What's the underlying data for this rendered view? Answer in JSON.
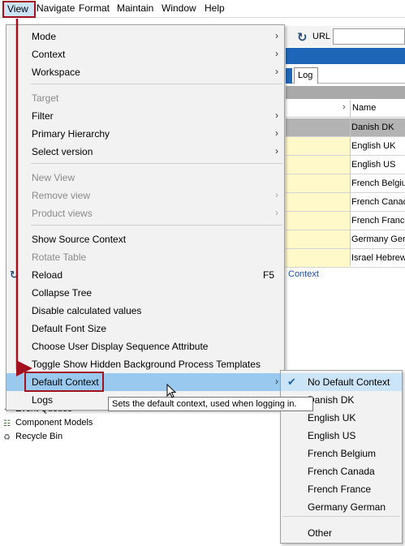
{
  "menubar": {
    "items": [
      "View",
      "Navigate",
      "Format",
      "Maintain",
      "Window",
      "Help"
    ]
  },
  "background": {
    "url_label": "URL",
    "log_tab": "Log",
    "column_name": "Name",
    "rows": [
      "Danish DK",
      "English UK",
      "English US",
      "French Belgium",
      "French Canada",
      "French France",
      "Germany German",
      "Israel Hebrew"
    ],
    "context_link": "Context",
    "tree": [
      "Event Queues",
      "Component Models",
      "Recycle Bin"
    ]
  },
  "view_menu": {
    "items": [
      {
        "label": "Mode",
        "submenu": true
      },
      {
        "label": "Context",
        "submenu": true
      },
      {
        "label": "Workspace",
        "submenu": true
      },
      {
        "label": "Target",
        "disabled": true
      },
      {
        "label": "Filter",
        "submenu": true
      },
      {
        "label": "Primary Hierarchy",
        "submenu": true
      },
      {
        "label": "Select version",
        "submenu": true
      },
      {
        "label": "New View",
        "disabled": true
      },
      {
        "label": "Remove view",
        "disabled": true,
        "submenu": true
      },
      {
        "label": "Product views",
        "disabled": true,
        "submenu": true
      },
      {
        "label": "Show Source Context"
      },
      {
        "label": "Rotate Table",
        "disabled": true
      },
      {
        "label": "Reload",
        "shortcut": "F5",
        "icon": "refresh-icon"
      },
      {
        "label": "Collapse Tree"
      },
      {
        "label": "Disable calculated values"
      },
      {
        "label": "Default Font Size"
      },
      {
        "label": "Choose User Display Sequence Attribute"
      },
      {
        "label": "Toggle Show Hidden Background Process Templates"
      },
      {
        "label": "Default Context",
        "submenu": true,
        "highlighted": true
      },
      {
        "label": "Logs"
      }
    ]
  },
  "tooltip": "Sets the default context, used when logging in.",
  "default_context_submenu": {
    "items": [
      {
        "label": "No Default Context",
        "checked": true
      },
      {
        "label": "Danish DK"
      },
      {
        "label": "English UK"
      },
      {
        "label": "English US"
      },
      {
        "label": "French Belgium"
      },
      {
        "label": "French Canada"
      },
      {
        "label": "French France"
      },
      {
        "label": "Germany German"
      },
      {
        "label": "Other"
      }
    ]
  },
  "colors": {
    "highlight": "#99c9ef",
    "annotation": "#a3111f",
    "check": "#1f5fa8",
    "brand_strip": "#1e66b7"
  }
}
